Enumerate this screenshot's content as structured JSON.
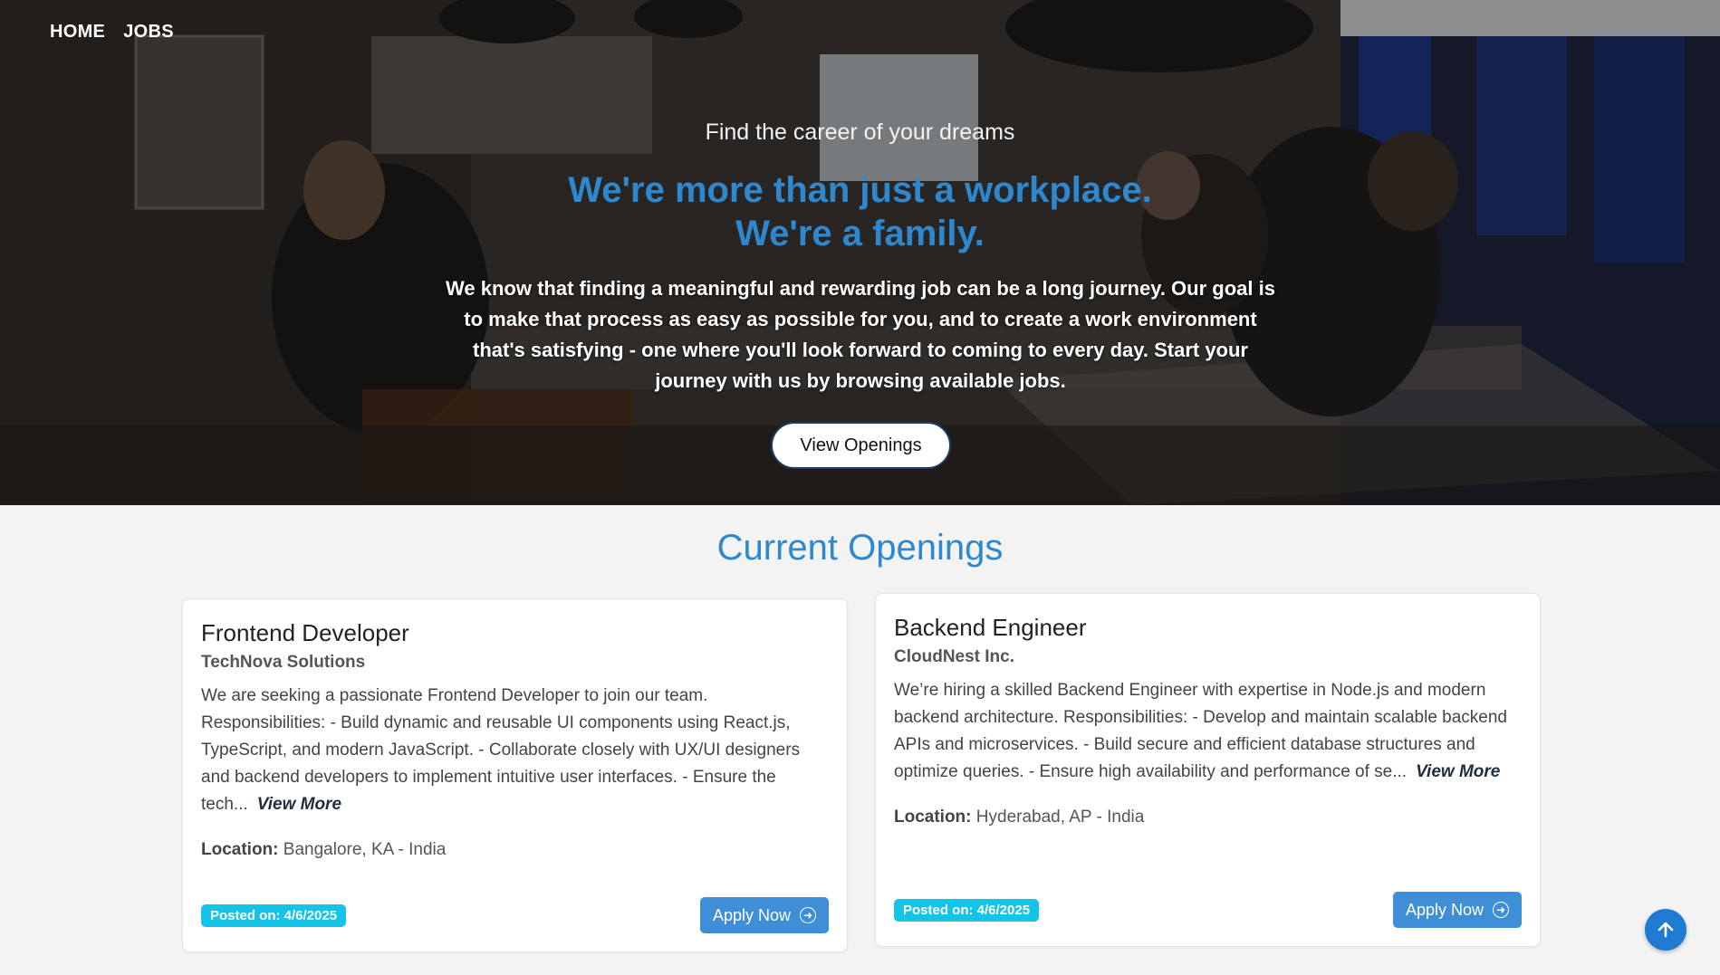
{
  "nav": {
    "home": "HOME",
    "jobs": "JOBS"
  },
  "hero": {
    "tagline": "Find the career of your dreams",
    "headline_line1": "We're more than just a workplace.",
    "headline_line2": "We're a family.",
    "intro": "We know that finding a meaningful and rewarding job can be a long journey. Our goal is to make that process as easy as possible for you, and to create a work environment that's satisfying - one where you'll look forward to coming to every day. Start your journey with us by browsing available jobs.",
    "cta": "View Openings"
  },
  "openings": {
    "title": "Current Openings",
    "view_more": "View More",
    "location_label": "Location:",
    "apply_label": "Apply Now",
    "jobs": [
      {
        "title": "Frontend Developer",
        "company": "TechNova Solutions",
        "description": "We are seeking a passionate Frontend Developer to join our team. Responsibilities: - Build dynamic and reusable UI components using React.js, TypeScript, and modern JavaScript. - Collaborate closely with UX/UI designers and backend developers to implement intuitive user interfaces. - Ensure the tech...",
        "location": "Bangalore, KA - India",
        "posted": "Posted on: 4/6/2025"
      },
      {
        "title": "Backend Engineer",
        "company": "CloudNest Inc.",
        "description": "We’re hiring a skilled Backend Engineer with expertise in Node.js and modern backend architecture. Responsibilities: - Develop and maintain scalable backend APIs and microservices. - Build secure and efficient database structures and optimize queries. - Ensure high availability and performance of se...",
        "location": "Hyderabad, AP - India",
        "posted": "Posted on: 4/6/2025"
      }
    ]
  },
  "colors": {
    "accent": "#2d88d0",
    "badge": "#16c3e8",
    "button": "#3f8fd8"
  },
  "icons": {
    "apply": "arrow-right-circle-icon",
    "scroll_top": "arrow-up-icon"
  }
}
